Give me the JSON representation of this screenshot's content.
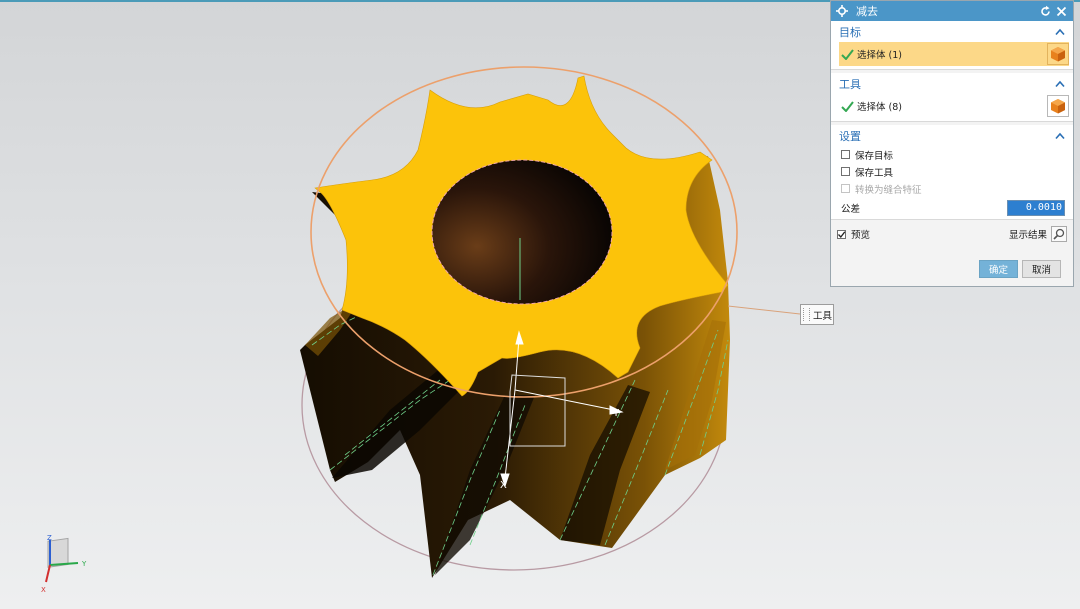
{
  "dialog": {
    "title": "减去",
    "target": {
      "header": "目标",
      "selection_label": "选择体 (1)"
    },
    "tool": {
      "header": "工具",
      "selection_label": "选择体 (8)"
    },
    "settings": {
      "header": "设置",
      "keep_target": "保存目标",
      "keep_tool": "保存工具",
      "convert_to_associative": "转换为缝合特征",
      "tolerance_label": "公差",
      "tolerance_value": "0.0010"
    },
    "preview": {
      "label": "预览",
      "checked": true,
      "show_result": "显示结果"
    },
    "ok": "确定",
    "cancel": "取消"
  },
  "viewport": {
    "tool_tag": "工具",
    "axis_labels": {
      "x": "X",
      "y": "Y",
      "z": "Z"
    },
    "triad": {
      "z": "Z",
      "y": "Y",
      "x": "X"
    }
  },
  "colors": {
    "accent": "#4b96c8",
    "gear_top": "#fcc30a",
    "gear_side_dark": "#1b1104",
    "gear_side_light": "#b57a08",
    "highlight": "#fcd888"
  }
}
